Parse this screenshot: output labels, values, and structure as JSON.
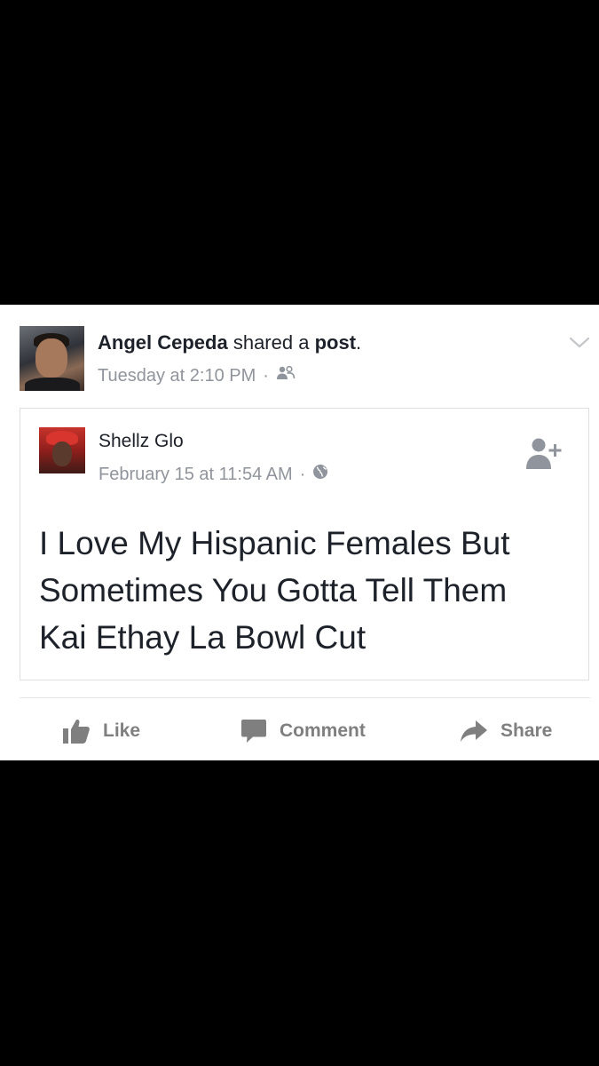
{
  "post": {
    "author": "Angel Cepeda",
    "action_text": "shared a",
    "object_text": "post",
    "period": ".",
    "timestamp": "Tuesday at 2:10 PM",
    "separator": "·",
    "audience_icon": "friends-icon",
    "menu_icon": "chevron-down-icon"
  },
  "shared_post": {
    "author": "Shellz Glo",
    "timestamp": "February 15 at 11:54 AM",
    "separator": "·",
    "audience_icon": "globe-icon",
    "add_friend_icon": "add-friend-icon",
    "text_lines": [
      "I Love My Hispanic Females But",
      "Sometimes You Gotta Tell Them",
      "Kai Ethay La Bowl Cut"
    ]
  },
  "actions": {
    "like": {
      "label": "Like",
      "icon": "thumbs-up-icon"
    },
    "comment": {
      "label": "Comment",
      "icon": "comment-icon"
    },
    "share": {
      "label": "Share",
      "icon": "share-arrow-icon"
    }
  },
  "colors": {
    "background": "#000000",
    "card": "#ffffff",
    "text_primary": "#1d2129",
    "text_secondary": "#90949c",
    "action_gray": "#7f7f7f"
  }
}
